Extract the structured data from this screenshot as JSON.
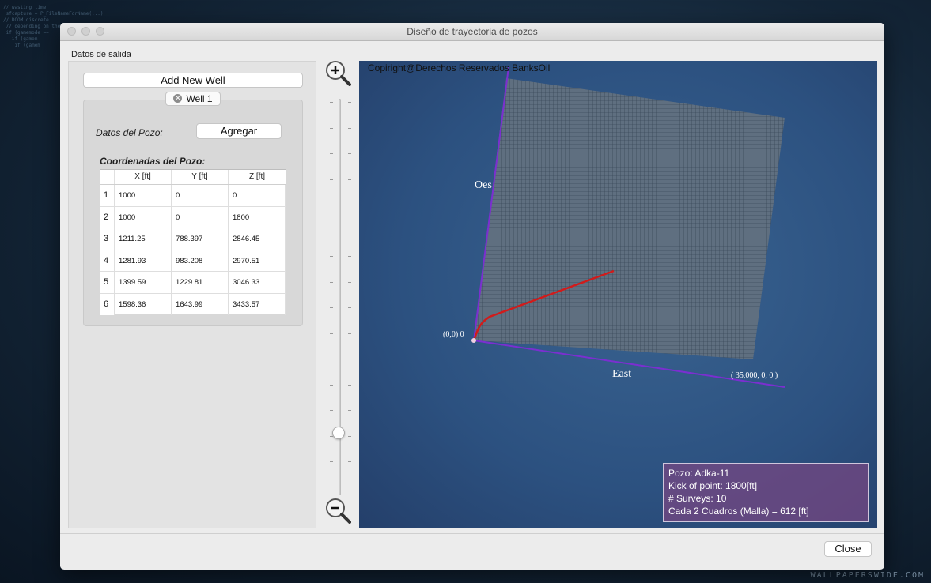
{
  "window": {
    "title": "Diseño de trayectoria de pozos"
  },
  "left_panel": {
    "section_label": "Datos de salida",
    "add_well_label": "Add New Well",
    "well_tab_label": "Well 1",
    "datos_label": "Datos del Pozo:",
    "agregar_label": "Agregar",
    "coords_label": "Coordenadas del Pozo:",
    "table": {
      "headers": [
        "X [ft]",
        "Y [ft]",
        "Z [ft]"
      ],
      "rows": [
        {
          "n": "1",
          "x": "1000",
          "y": "0",
          "z": "0"
        },
        {
          "n": "2",
          "x": "1000",
          "y": "0",
          "z": "1800"
        },
        {
          "n": "3",
          "x": "1211.25",
          "y": "788.397",
          "z": "2846.45"
        },
        {
          "n": "4",
          "x": "1281.93",
          "y": "983.208",
          "z": "2970.51"
        },
        {
          "n": "5",
          "x": "1399.59",
          "y": "1229.81",
          "z": "3046.33"
        },
        {
          "n": "6",
          "x": "1598.36",
          "y": "1643.99",
          "z": "3433.57"
        }
      ]
    }
  },
  "viewport": {
    "copyright": "Copiright@Derechos Reservados BanksOil",
    "label_west": "Oes",
    "label_east": "East",
    "origin_label": "(0,0) 0",
    "corner_label": "( 35,000, 0, 0 )",
    "info": {
      "pozo": "Pozo: Adka-11",
      "kick": "Kick of point: 1800[ft]",
      "surveys": "# Surveys: 10",
      "malla": "Cada 2 Cuadros (Malla) = 612 [ft]"
    }
  },
  "footer": {
    "close_label": "Close"
  },
  "desktop": {
    "wallpaper_mark": "WALLPAPERSWIDE.COM"
  },
  "colors": {
    "axis": "#7b2fd0",
    "well_path": "#d11b1b",
    "grid": "#3a4a5a"
  }
}
